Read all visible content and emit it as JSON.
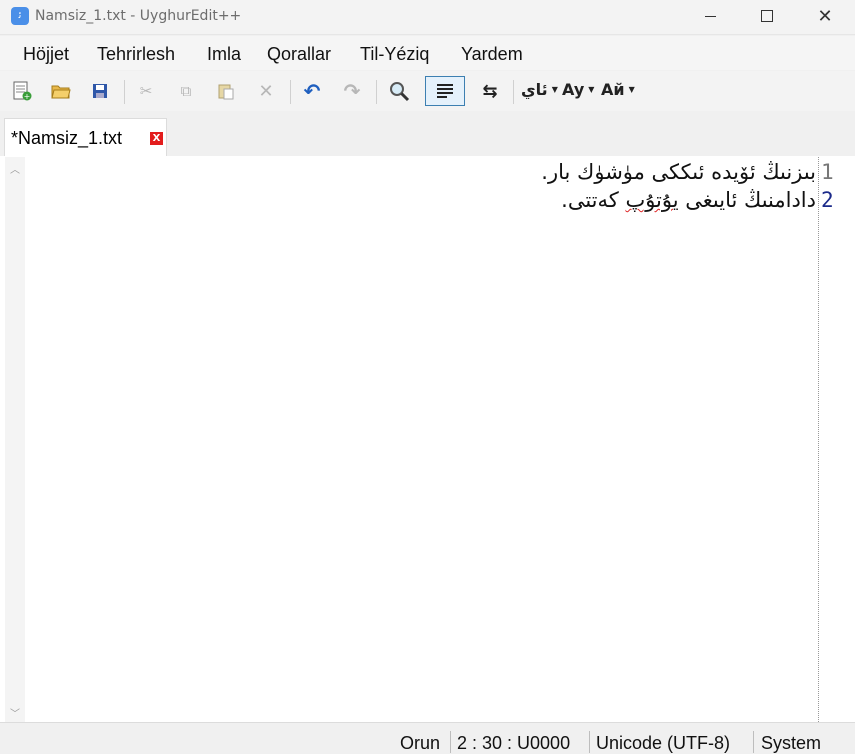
{
  "window": {
    "title": "Namsiz_1.txt - UyghurEdit++",
    "app_icon": "uyghuredit-icon"
  },
  "menu": {
    "items": [
      "Höjjet",
      "Tehrirlesh",
      "Imla",
      "Qorallar",
      "Til-Yéziq",
      "Yardem"
    ]
  },
  "toolbar": {
    "icons": [
      "new-file-icon",
      "open-folder-icon",
      "save-icon",
      "cut-icon",
      "copy-icon",
      "paste-icon",
      "delete-icon",
      "undo-icon",
      "redo-icon",
      "search-icon",
      "word-wrap-icon",
      "swap-direction-icon"
    ],
    "dropdowns": [
      "ئاي",
      "Ay",
      "Ай"
    ]
  },
  "tab": {
    "label": "*Namsiz_1.txt"
  },
  "editor": {
    "lines": [
      {
        "number": "1",
        "text": "بىزنىڭ ئۆيدە ئىككى مۈشۈك بار."
      },
      {
        "number": "2",
        "before": "دادامنىڭ ئايىغى ",
        "misspelled": "يۇتۇپ",
        "after": " كەتتى."
      }
    ]
  },
  "status": {
    "orun_label": "Orun",
    "position": "2 : 30 : U0000",
    "encoding": "Unicode (UTF-8)",
    "keyboard": "System"
  },
  "colors": {
    "close_tab": "#e31d1d",
    "current_line_number": "#1b2a8a",
    "spell_error": "#dd2222"
  }
}
